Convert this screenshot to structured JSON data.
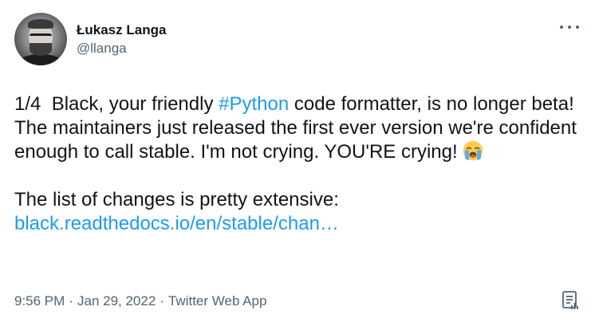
{
  "author": {
    "display_name": "Łukasz Langa",
    "handle": "@llanga"
  },
  "tweet": {
    "prefix": "1/4  Black, your friendly ",
    "hashtag": "#Python",
    "middle": " code formatter, is no longer beta! The maintainers just released the first ever version we're confident enough to call stable. I'm not crying. YOU'RE crying!",
    "emoji_name": "loudly-crying-face",
    "paragraph2": "The list of changes is pretty extensive:",
    "link": "black.readthedocs.io/en/stable/chan…"
  },
  "meta": {
    "time": "9:56 PM",
    "separator": "·",
    "date": "Jan 29, 2022",
    "source": "Twitter Web App"
  },
  "icons": {
    "more": "more-dots-icon",
    "analytics": "analytics-icon"
  },
  "colors": {
    "link": "#1d9bf0",
    "text": "#0f1419",
    "secondary": "#536471"
  }
}
